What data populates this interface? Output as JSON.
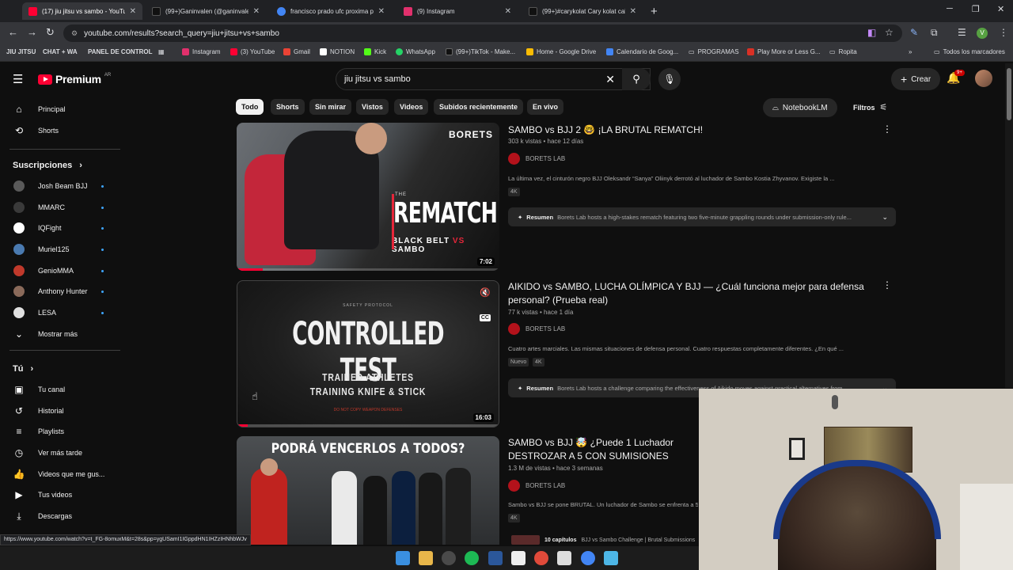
{
  "browser": {
    "tabs": [
      {
        "title": "(17) jiu jitsu vs sambo - YouTube",
        "icon": "youtube-icon",
        "color": "#ff0033",
        "active": true
      },
      {
        "title": "(99+)Ganinvalen (@ganinvalen)",
        "icon": "tiktok-icon",
        "color": "#111111",
        "active": false
      },
      {
        "title": "francisco prado ufc proxima pelea",
        "icon": "google-icon",
        "color": "#4285f4",
        "active": false
      },
      {
        "title": "(9) Instagram",
        "icon": "instagram-icon",
        "color": "#e1306c",
        "active": false
      },
      {
        "title": "(99+)#carykolat Cary kolat calls",
        "icon": "tiktok-icon",
        "color": "#111111",
        "active": false
      }
    ],
    "url": "youtube.com/results?search_query=jiu+jitsu+vs+sambo",
    "profile_initial": "V",
    "bookmarks": [
      {
        "label": "JIU JITSU",
        "bold": true,
        "color": ""
      },
      {
        "label": "CHAT + WA",
        "bold": true,
        "color": ""
      },
      {
        "label": "PANEL DE CONTROL",
        "bold": true,
        "color": ""
      },
      {
        "label": "Instagram",
        "bold": false,
        "color": "#e1306c"
      },
      {
        "label": "(3) YouTube",
        "bold": false,
        "color": "#ff0033"
      },
      {
        "label": "Gmail",
        "bold": false,
        "color": "#ea4335"
      },
      {
        "label": "NOTION",
        "bold": false,
        "color": "#ffffff"
      },
      {
        "label": "Kick",
        "bold": false,
        "color": "#53fc18"
      },
      {
        "label": "WhatsApp",
        "bold": false,
        "color": "#25d366"
      },
      {
        "label": "(99+)TikTok - Make...",
        "bold": false,
        "color": "#111111"
      },
      {
        "label": "Home - Google Drive",
        "bold": false,
        "color": "#fbbc04"
      },
      {
        "label": "Calendario de Goog...",
        "bold": false,
        "color": "#4285f4"
      },
      {
        "label": "PROGRAMAS",
        "bold": false,
        "color": ""
      },
      {
        "label": "Play More or Less G...",
        "bold": false,
        "color": "#d93025"
      },
      {
        "label": "Ropita",
        "bold": false,
        "color": ""
      }
    ],
    "all_bookmarks": "Todos los marcadores",
    "status_url": "https://www.youtube.com/watch?v=t_FG-8omuxM&t=28s&pp=ygUSamI1IGppdHN1IHZzIHNhbWJv"
  },
  "yt": {
    "logo": "Premium",
    "country": "AR",
    "search_value": "jiu jitsu vs sambo",
    "create": "Crear",
    "notif_badge": "9+",
    "sidebar": {
      "main": [
        "Principal",
        "Shorts"
      ],
      "subs_header": "Suscripciones",
      "subs": [
        {
          "name": "Josh Beam BJJ",
          "color": "#5a5a5a"
        },
        {
          "name": "MMARC",
          "color": "#3a3a3a"
        },
        {
          "name": "IQFight",
          "color": "#ffffff"
        },
        {
          "name": "Muriel125",
          "color": "#4a7ab0"
        },
        {
          "name": "GenioMMA",
          "color": "#c0392b"
        },
        {
          "name": "Anthony Hunter",
          "color": "#8a6a5a"
        },
        {
          "name": "LESA",
          "color": "#e0e0e0"
        }
      ],
      "show_more": "Mostrar más",
      "you_header": "Tú",
      "you": [
        "Tu canal",
        "Historial",
        "Playlists",
        "Ver más tarde",
        "Videos que me gus...",
        "Tus videos",
        "Descargas"
      ]
    },
    "chips": [
      "Todo",
      "Shorts",
      "Sin mirar",
      "Vistos",
      "Videos",
      "Subidos recientemente",
      "En vivo"
    ],
    "notebook": "NotebookLM",
    "filters": "Filtros",
    "results": [
      {
        "title": "SAMBO vs BJJ 2 🤓 ¡LA BRUTAL REMATCH!",
        "meta": "303 k vistas • hace 12 días",
        "channel": "BORETS LAB",
        "desc": "La última vez, el cinturón negro BJJ Oleksandr “Sanya” Oliinyk derrotó al luchador de Sambo Kostia Zhyvanov. Exigiste la ...",
        "badges": [
          "4K"
        ],
        "summary_label": "Resumen",
        "summary": "Borets Lab hosts a high-stakes rematch featuring two five-minute grappling rounds under submission-only rule...",
        "duration": "7:02",
        "thumb": {
          "brand": "BORETS",
          "the": "THE",
          "big": "REMATCH",
          "left": "BLACK BELT",
          "vs": "VS",
          "right": "SAMBO"
        },
        "progress": 0.1
      },
      {
        "title": "AIKIDO vs SAMBO, LUCHA OLÍMPICA Y BJJ — ¿Cuál funciona mejor para defensa personal? (Prueba real)",
        "meta": "77 k vistas • hace 1 día",
        "channel": "BORETS LAB",
        "desc": "Cuatro artes marciales. Las mismas situaciones de defensa personal. Cuatro respuestas completamente diferentes. ¿En qué ...",
        "badges": [
          "Nuevo",
          "4K"
        ],
        "summary_label": "Resumen",
        "summary": "Borets Lab hosts a challenge comparing the effectiveness of Aikido moves against practical alternatives from...",
        "duration": "16:03",
        "thumb": {
          "small": "SAFETY PROTOCOL",
          "big": "CONTROLLED TEST",
          "line1": "TRAINED ATHLETES",
          "line2": "TRAINING KNIFE & STICK",
          "tiny": "DO NOT COPY WEAPON DEFENSES",
          "cc": "CC"
        },
        "progress": 0.04
      },
      {
        "title": "SAMBO vs BJJ 🤯 ¿Puede 1 Luchador DESTROZAR A 5 CON SUMISIONES BRUTALES",
        "meta": "1.3 M de vistas • hace 3 semanas",
        "channel": "BORETS LAB",
        "desc": "Sambo vs BJJ se pone BRUTAL. Un luchador de Sambo se enfrenta a 5 cinturones ...",
        "badges": [
          "4K"
        ],
        "chapters_label": "10 capítulos",
        "chapters": "BJJ vs Sambo Challenge | Brutal Submissions",
        "thumb": {
          "banner": "PODRÁ VENCERLOS A TODOS?"
        }
      }
    ]
  }
}
